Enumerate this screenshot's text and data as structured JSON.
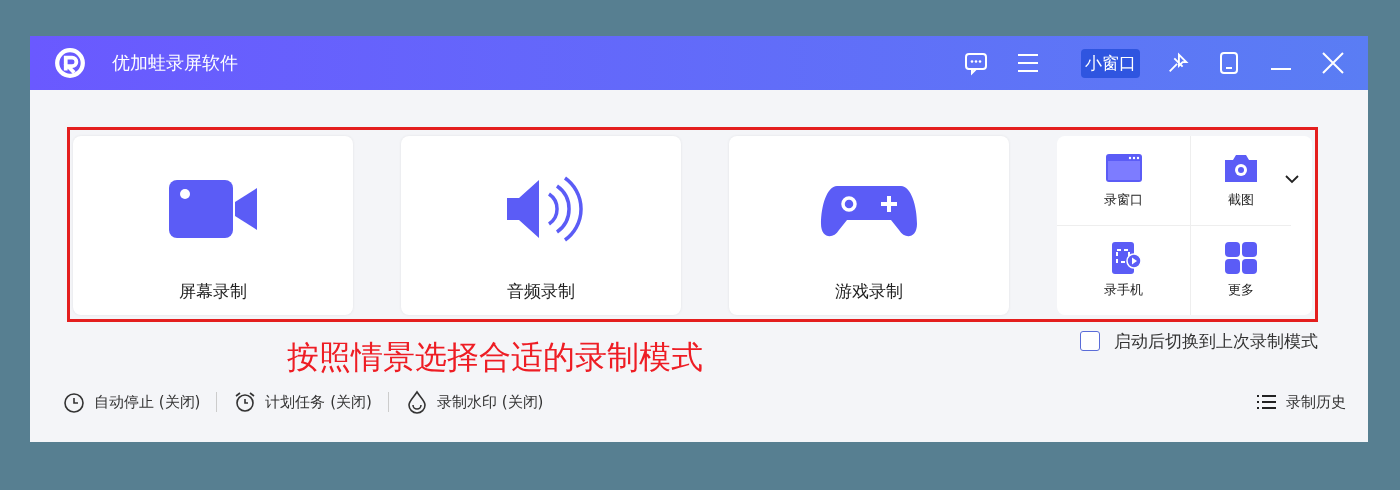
{
  "window": {
    "title": "优加蛙录屏软件",
    "mini_window_button": {
      "label": "小窗口",
      "selected": true
    }
  },
  "modes": [
    {
      "label": "屏幕录制"
    },
    {
      "label": "音频录制"
    },
    {
      "label": "游戏录制"
    }
  ],
  "tools": [
    {
      "label": "录窗口"
    },
    {
      "label": "截图"
    },
    {
      "label": "录手机"
    },
    {
      "label": "更多"
    }
  ],
  "annotation": "按照情景选择合适的录制模式",
  "restore_option": {
    "label": "启动后切换到上次录制模式",
    "checked": false
  },
  "status_bar": {
    "items": [
      {
        "label": "自动停止 (关闭)"
      },
      {
        "label": "计划任务 (关闭)"
      },
      {
        "label": "录制水印 (关闭)"
      }
    ],
    "history": "录制历史"
  }
}
